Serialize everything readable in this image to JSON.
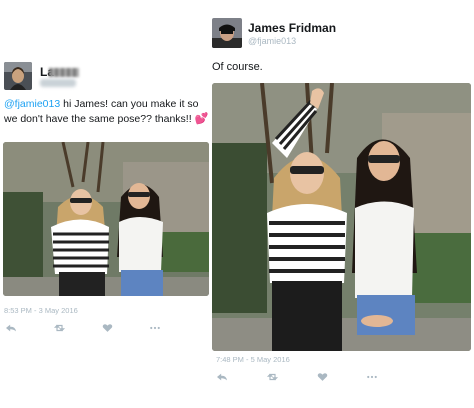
{
  "left_tweet": {
    "name": "La",
    "handle": "",
    "text_mention": "@fjamie013",
    "text_body": " hi James! can you make it so we don't have the same pose?? thanks!!",
    "emoji": "💕",
    "timestamp": "8:53 PM - 3 May 2016",
    "actions": [
      "reply-icon",
      "retweet-icon",
      "like-icon",
      "more-icon"
    ]
  },
  "right_tweet": {
    "name": "James Fridman",
    "handle": "@fjamie013",
    "text": "Of course.",
    "timestamp": "7:48 PM - 5 May 2016",
    "actions": [
      "reply-icon",
      "retweet-icon",
      "like-icon",
      "more-icon"
    ]
  },
  "colors": {
    "link": "#1da1f2",
    "muted": "#aab8c2",
    "text": "#14171a",
    "heart": "#e0245e"
  }
}
